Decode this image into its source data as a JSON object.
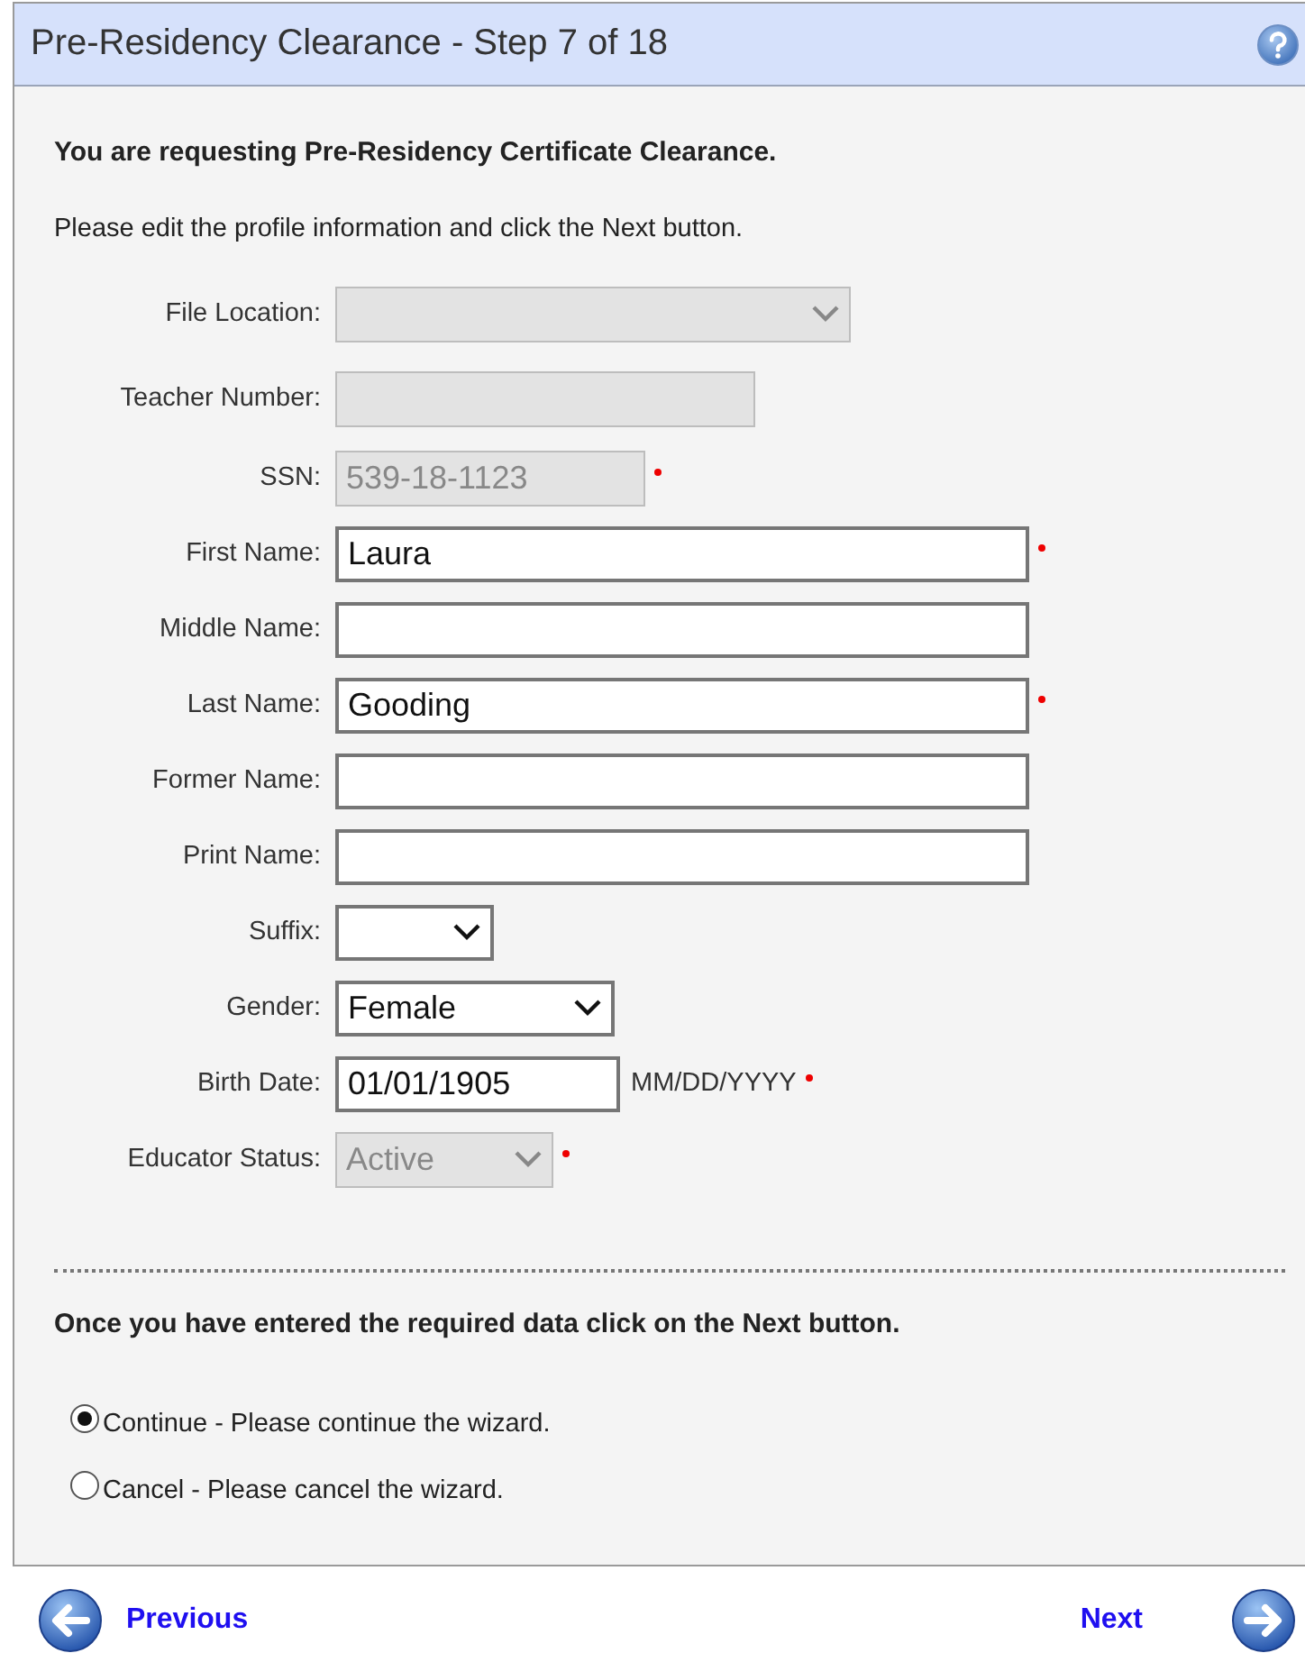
{
  "window": {
    "title": "Pre-Residency Clearance - Step 7 of 18"
  },
  "intro": {
    "heading": "You are requesting Pre-Residency Certificate Clearance.",
    "text": "Please edit the profile information and click the Next button."
  },
  "fields": [
    {
      "label": "File Location:",
      "kind": "select",
      "disabled": true,
      "required": false
    },
    {
      "label": "Teacher Number:",
      "kind": "input",
      "disabled": true,
      "required": false
    },
    {
      "label": "SSN:",
      "kind": "input",
      "value": "539-18-1123",
      "disabled": true,
      "required": true
    },
    {
      "label": "First Name:",
      "kind": "input",
      "value": "Laura",
      "disabled": false,
      "required": true
    },
    {
      "label": "Middle Name:",
      "kind": "input",
      "disabled": false,
      "required": false
    },
    {
      "label": "Last Name:",
      "kind": "input",
      "value": "Gooding",
      "disabled": false,
      "required": true
    },
    {
      "label": "Former Name:",
      "kind": "input",
      "disabled": false,
      "required": false
    },
    {
      "label": "Print Name:",
      "kind": "input",
      "disabled": false,
      "required": false
    },
    {
      "label": "Suffix:",
      "kind": "select",
      "disabled": false,
      "required": false
    },
    {
      "label": "Gender:",
      "kind": "select",
      "value": "Female",
      "disabled": false,
      "required": false
    },
    {
      "label": "Birth Date:",
      "kind": "input",
      "value": "01/01/1905",
      "disabled": false,
      "required": true,
      "hint": "MM/DD/YYYY"
    },
    {
      "label": "Educator Status:",
      "kind": "select",
      "value": "Active",
      "disabled": true,
      "required": true
    }
  ],
  "instruction": "Once you have entered the required data click on the Next button.",
  "options": [
    {
      "label": "Continue - Please continue the wizard.",
      "selected": true
    },
    {
      "label": "Cancel - Please cancel the wizard.",
      "selected": false
    }
  ],
  "footer": {
    "previous": "Previous",
    "next": "Next"
  }
}
